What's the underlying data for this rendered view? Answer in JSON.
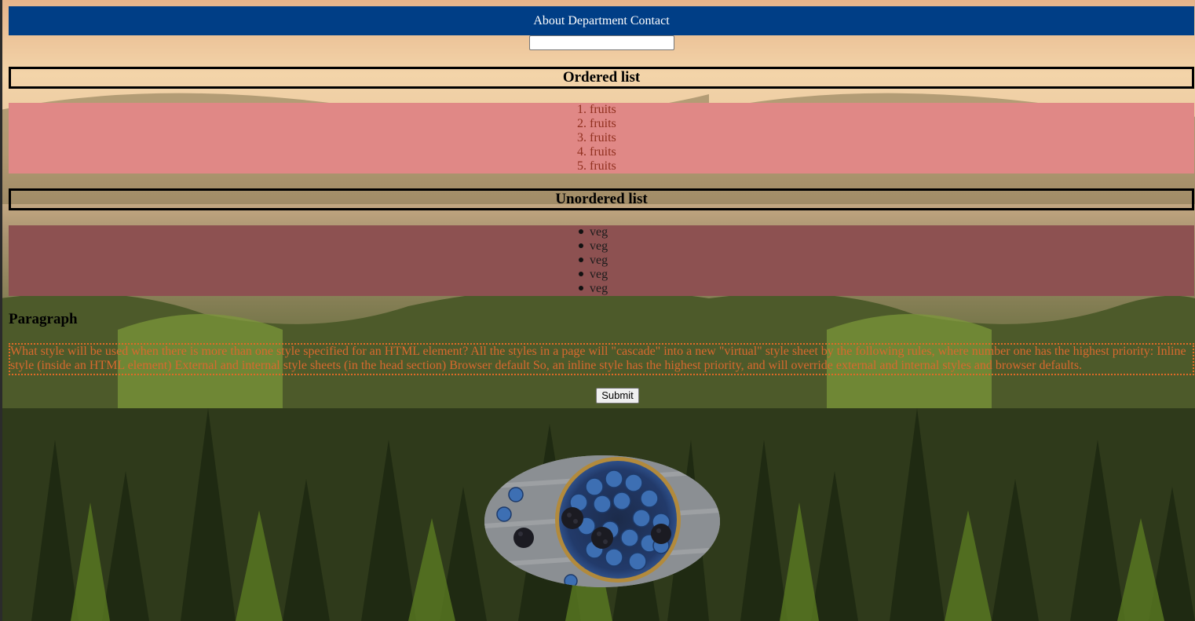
{
  "nav": {
    "items": [
      "About",
      "Department",
      "Contact"
    ]
  },
  "search": {
    "value": ""
  },
  "ordered_list": {
    "heading": "Ordered list",
    "items": [
      {
        "marker": "1.",
        "label": "fruits"
      },
      {
        "marker": "2.",
        "label": "fruits"
      },
      {
        "marker": "3.",
        "label": "fruits"
      },
      {
        "marker": "4.",
        "label": "fruits"
      },
      {
        "marker": "5.",
        "label": "fruits"
      }
    ]
  },
  "unordered_list": {
    "heading": "Unordered list",
    "items": [
      "veg",
      "veg",
      "veg",
      "veg",
      "veg"
    ]
  },
  "paragraph": {
    "heading": "Paragraph",
    "text": "What style will be used when there is more than one style specified for an HTML element? All the styles in a page will \"cascade\" into a new \"virtual\" style sheet by the following rules, where number one has the highest priority: Inline style (inside an HTML element) External and internal style sheets (in the head section) Browser default So, an inline style has the highest priority, and will override external and internal styles and browser defaults."
  },
  "form": {
    "submit_label": "Submit"
  },
  "image": {
    "subject": "bowl of blueberries and blackberries"
  },
  "colors": {
    "navbar": "#003e86",
    "ordered_bg": "#e08886",
    "ordered_text": "#8f2f1e",
    "unordered_bg": "#8d5151",
    "paragraph_text": "#d9692e",
    "paragraph_border": "#e06a26"
  }
}
